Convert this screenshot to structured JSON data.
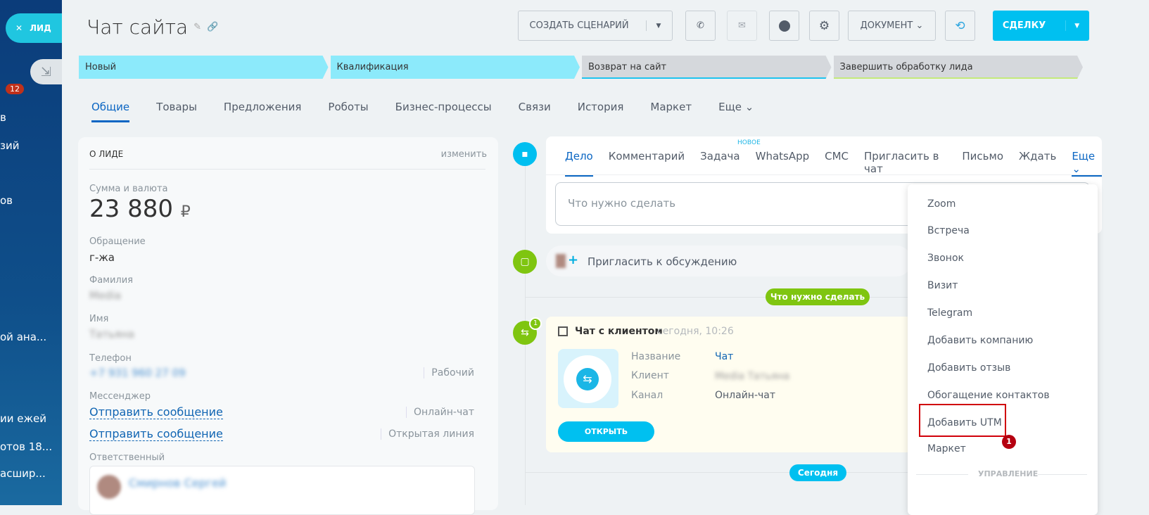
{
  "sidebar": {
    "lead_label": "ЛИД",
    "badge": "12",
    "fragments": [
      "в",
      "зий",
      "ов",
      "ой ана...",
      "ии ежей",
      "отов 18...",
      "асшир..."
    ]
  },
  "header": {
    "title": "Чат сайта",
    "create_scenario": "СОЗДАТЬ СЦЕНАРИЙ",
    "document": "ДОКУМЕНТ",
    "deal": "СДЕЛКУ"
  },
  "stages": [
    "Новый",
    "Квалификация",
    "Возврат на сайт",
    "Завершить обработку лида"
  ],
  "tabs": [
    "Общие",
    "Товары",
    "Предложения",
    "Роботы",
    "Бизнес-процессы",
    "Связи",
    "История",
    "Маркет",
    "Еще"
  ],
  "about": {
    "title": "О ЛИДЕ",
    "edit": "изменить",
    "sum_label": "Сумма и валюта",
    "sum": "23 880",
    "currency": "₽",
    "appeal_label": "Обращение",
    "appeal": "г-жа",
    "lastname_label": "Фамилия",
    "lastname": "Media",
    "name_label": "Имя",
    "name": "Татьяна",
    "phone_label": "Телефон",
    "phone": "+7 931 960 27 09",
    "phone_type": "Рабочий",
    "messenger_label": "Мессенджер",
    "send1": "Отправить сообщение",
    "send1_type": "Онлайн-чат",
    "send2": "Отправить сообщение",
    "send2_type": "Открытая линия",
    "responsible_label": "Ответственный",
    "responsible": "Смирнов Сергей"
  },
  "editor": {
    "tabs": [
      "Дело",
      "Комментарий",
      "Задача",
      "WhatsApp",
      "СМС",
      "Пригласить в чат",
      "Письмо",
      "Ждать",
      "Еще"
    ],
    "new_badge": "НОВОЕ",
    "placeholder": "Что нужно сделать"
  },
  "invite": "Пригласить к обсуждению",
  "todo_badge": "Что нужно сделать",
  "chat": {
    "title": "Чат с клиентом",
    "time": "сегодня, 10:26",
    "name_label": "Название",
    "name": "Чат",
    "client_label": "Клиент",
    "client": "Media Татьяна",
    "channel_label": "Канал",
    "channel": "Онлайн-чат",
    "open": "ОТКРЫТЬ",
    "count": "1"
  },
  "today": "Сегодня",
  "menu": {
    "items": [
      "Zoom",
      "Встреча",
      "Звонок",
      "Визит",
      "Telegram",
      "Добавить компанию",
      "Добавить отзыв",
      "Обогащение контактов",
      "Добавить UTM",
      "Маркет"
    ],
    "section": "УПРАВЛЕНИЕ",
    "marker": "1"
  }
}
